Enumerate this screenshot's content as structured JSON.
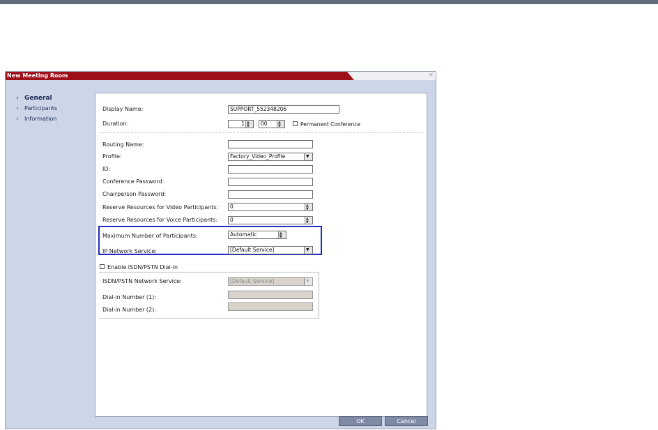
{
  "dialog": {
    "title": "New Meeting Room",
    "close_glyph": "×",
    "nav": [
      {
        "label": "General",
        "active": true
      },
      {
        "label": "Participants",
        "active": false
      },
      {
        "label": "Information",
        "active": false
      }
    ],
    "fields": {
      "display_name": {
        "label": "Display Name:",
        "value": "SUPPORT_552348206"
      },
      "duration": {
        "label": "Duration:",
        "hours": "1",
        "separator": ":",
        "minutes": "00"
      },
      "permanent_conference": {
        "label": "Permanent Conference",
        "checked": false
      },
      "routing_name": {
        "label": "Routing Name:",
        "value": ""
      },
      "profile": {
        "label": "Profile:",
        "value": "Factory_Video_Profile"
      },
      "id": {
        "label": "ID:",
        "value": ""
      },
      "conference_password": {
        "label": "Conference Password:",
        "value": ""
      },
      "chairperson_password": {
        "label": "Chairperson Password:",
        "value": ""
      },
      "reserve_video": {
        "label": "Reserve Resources for Video Participants:",
        "value": "0"
      },
      "reserve_voice": {
        "label": "Reserve Resources for Voice Participants:",
        "value": "0"
      },
      "max_participants": {
        "label": "Maximum Number of Participants:",
        "value": "Automatic"
      },
      "ip_network_service": {
        "label": "IP Network Service:",
        "value": "[Default Service]"
      },
      "enable_isdn": {
        "label": "Enable ISDN/PSTN Dial-in",
        "checked": false
      },
      "isdn_network_service": {
        "label": "ISDN/PSTN Network Service:",
        "value": "[Default Service]"
      },
      "dialin_1": {
        "label": "Dial-in Number (1):",
        "value": ""
      },
      "dialin_2": {
        "label": "Dial-in Number (2):",
        "value": ""
      }
    },
    "buttons": {
      "ok": "OK",
      "cancel": "Cancel"
    }
  }
}
